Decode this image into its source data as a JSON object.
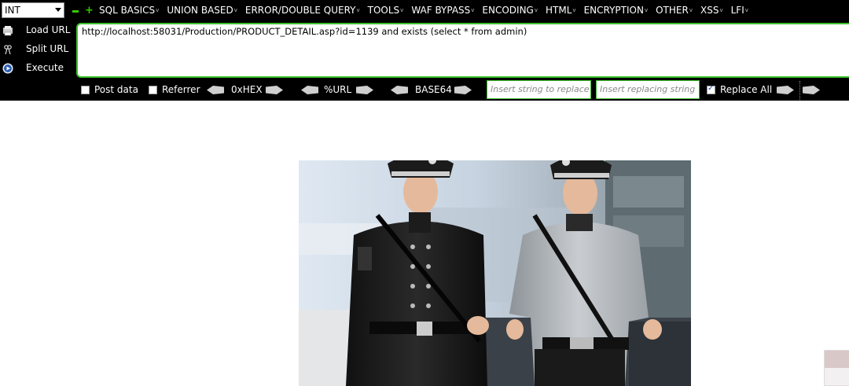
{
  "injection_type": {
    "selected": "INT"
  },
  "menu": [
    "SQL BASICS",
    "UNION BASED",
    "ERROR/DOUBLE QUERY",
    "TOOLS",
    "WAF BYPASS",
    "ENCODING",
    "HTML",
    "ENCRYPTION",
    "OTHER",
    "XSS",
    "LFI"
  ],
  "actions": {
    "load_url": "Load URL",
    "split_url": "Split URL",
    "execute": "Execute"
  },
  "url": {
    "value": "http://localhost:58031/Production/PRODUCT_DETAIL.asp?id=1139 and exists (select * from admin)"
  },
  "options": {
    "post_data": "Post data",
    "referrer": "Referrer",
    "hex": "0xHEX",
    "url_enc": "%URL",
    "base64": "BASE64",
    "replace_from_placeholder": "Insert string to replace",
    "replace_to_placeholder": "Insert replacing string",
    "replace_all": "Replace All",
    "replace_all_checked": true
  },
  "colors": {
    "toolbar_bg": "#000000",
    "accent_green": "#3bbf2a",
    "text": "#ffffff"
  }
}
